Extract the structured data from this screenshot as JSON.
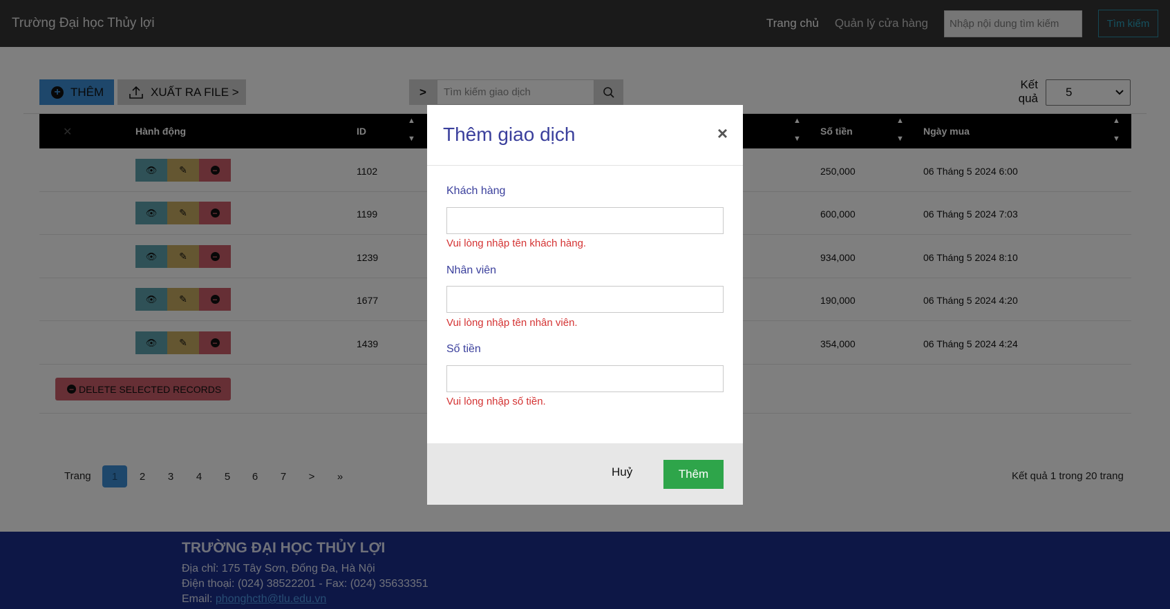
{
  "navbar": {
    "brand": "Trường Đại học Thủy lợi",
    "links": [
      "Trang chủ",
      "Quản lý cửa hàng"
    ],
    "search_placeholder": "Nhập nội dung tìm kiếm",
    "search_button": "Tìm kiếm"
  },
  "toolbar": {
    "add_label": "THÊM",
    "export_label": "XUẤT RA FILE >",
    "search_prefix": ">",
    "search_placeholder": "Tìm kiếm giao dịch",
    "result_label": "Kết quả",
    "result_value": "5"
  },
  "table": {
    "columns": [
      "Hành động",
      "ID",
      "Số tiền",
      "Ngày mua"
    ],
    "rows": [
      {
        "id": "1102",
        "amount": "250,000",
        "date": "06 Tháng 5 2024 6:00"
      },
      {
        "id": "1199",
        "amount": "600,000",
        "date": "06 Tháng 5 2024 7:03"
      },
      {
        "id": "1239",
        "amount": "934,000",
        "date": "06 Tháng 5 2024 8:10"
      },
      {
        "id": "1677",
        "amount": "190,000",
        "date": "06 Tháng 5 2024 4:20"
      },
      {
        "id": "1439",
        "amount": "354,000",
        "date": "06 Tháng 5 2024 4:24"
      }
    ],
    "delete_selected_label": "DELETE SELECTED RECORDS"
  },
  "pagination": {
    "label": "Trang",
    "pages": [
      "1",
      "2",
      "3",
      "4",
      "5",
      "6",
      "7",
      ">",
      "»"
    ],
    "active": "1",
    "summary": "Kết quả 1 trong 20 trang"
  },
  "footer": {
    "title": "TRƯỜNG ĐẠI HỌC THỦY LỢI",
    "address": "Địa chỉ: 175 Tây Sơn, Đống Đa, Hà Nội",
    "phone": "Điện thoại: (024) 38522201 - Fax: (024) 35633351",
    "email_label": "Email: ",
    "email": "phonghcth@tlu.edu.vn"
  },
  "modal": {
    "title": "Thêm giao dịch",
    "close": "×",
    "fields": [
      {
        "label": "Khách hàng",
        "value": "",
        "error": "Vui lòng nhập tên khách hàng."
      },
      {
        "label": "Nhân viên",
        "value": "",
        "error": "Vui lòng nhập tên nhân viên."
      },
      {
        "label": "Số tiền",
        "value": "",
        "error": "Vui lòng nhập số tiền."
      }
    ],
    "cancel_label": "Huỷ",
    "submit_label": "Thêm"
  },
  "colors": {
    "navbar_bg": "#343434",
    "primary": "#3d8fd6",
    "success": "#2ea54a",
    "danger": "#cc5f6a",
    "warning": "#c9ad62",
    "info": "#5fa3af",
    "footer_bg": "#1a2f8c",
    "modal_title": "#3a3f9c",
    "error_text": "#d43333"
  }
}
